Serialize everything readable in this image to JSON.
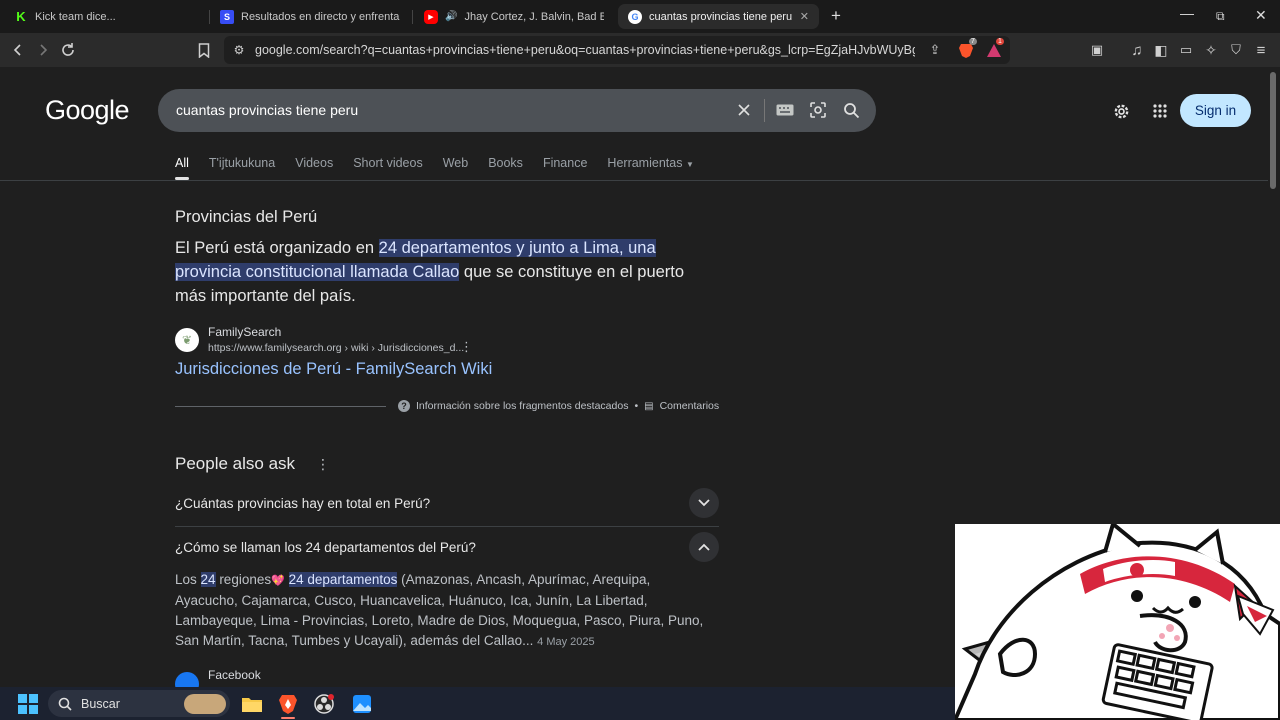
{
  "tabs": [
    {
      "title": "Kick team dice...",
      "favicon": "kick-icon"
    },
    {
      "title": "Resultados en directo y enfrentamien",
      "favicon": "sofascore-icon"
    },
    {
      "title": "Jhay Cortez, J. Balvin, Bad Bunny",
      "favicon": "youtube-icon"
    },
    {
      "title": "cuantas provincias tiene peru - N",
      "favicon": "google-icon"
    }
  ],
  "url": "google.com/search?q=cuantas+provincias+tiene+peru&oq=cuantas+provincias+tiene+peru&gs_lcrp=EgZjaHJvbWUyBggAEE...",
  "brave_badge": "7",
  "rewards_badge": "1",
  "logo": "Google",
  "query": "cuantas provincias tiene peru",
  "sign_in": "Sign in",
  "search_tabs": [
    "All",
    "T'ijtukukuna",
    "Videos",
    "Short videos",
    "Web",
    "Books",
    "Finance",
    "Herramientas"
  ],
  "snippet": {
    "title": "Provincias del Perú",
    "pre": "El Perú está organizado en ",
    "highlight1": "24 departamentos y junto a Lima, una",
    "highlight2": "provincia constitucional llamada Callao",
    "post": " que se constituye en el puerto más importante del país.",
    "source_name": "FamilySearch",
    "source_url": "https://www.familysearch.org › wiki › Jurisdicciones_d...",
    "link": "Jurisdicciones de Perú - FamilySearch Wiki",
    "about": "Información sobre los fragmentos destacados",
    "feedback": "Comentarios"
  },
  "paa": {
    "title": "People also ask",
    "q1": "¿Cuántas provincias hay en total en Perú?",
    "q2": "¿Cómo se llaman los 24 departamentos del Perú?",
    "a_pre": "Los ",
    "a_h1": "24",
    "a_mid": " regiones",
    "a_emoji": "💖",
    "a_h2": "24 departamentos",
    "a_rest": " (Amazonas, Ancash, Apurímac, Arequipa, Ayacucho, Cajamarca, Cusco, Huancavelica, Huánuco, Ica, Junín, La Libertad, Lambayeque, Lima - Provincias, Loreto, Madre de Dios, Moquegua, Pasco, Piura, Puno, San Martín, Tacna, Tumbes y Ucayali), además del Callao... ",
    "a_date": "4 May 2025",
    "next_source": "Facebook"
  },
  "taskbar": {
    "search": "Buscar"
  }
}
